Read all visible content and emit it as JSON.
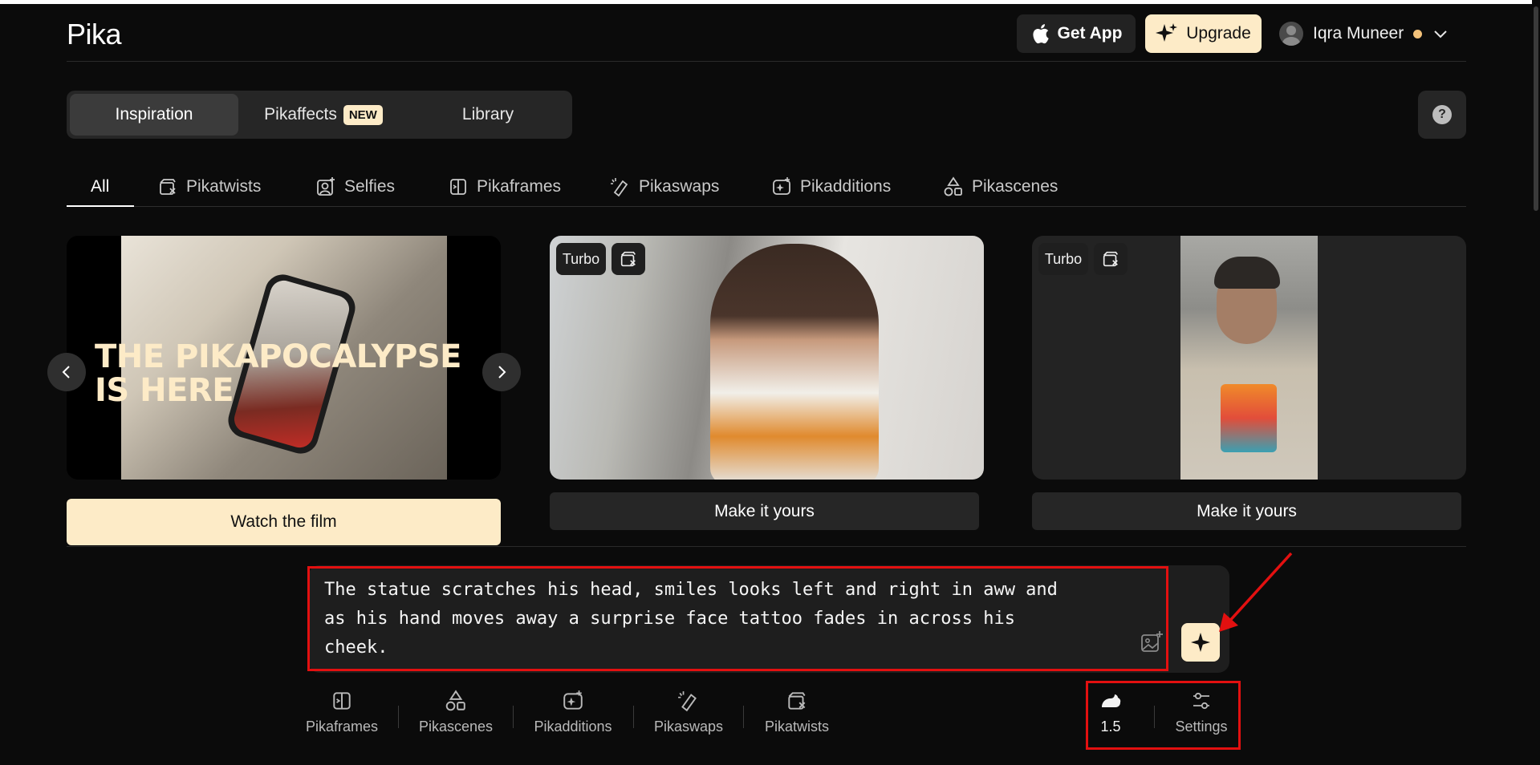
{
  "app": {
    "logo": "Pika"
  },
  "header": {
    "get_app_label": "Get App",
    "upgrade_label": "Upgrade",
    "user_name": "Iqra Muneer"
  },
  "main_tabs": [
    {
      "label": "Inspiration",
      "active": true
    },
    {
      "label": "Pikaffects",
      "badge": "NEW",
      "active": false
    },
    {
      "label": "Library",
      "active": false
    }
  ],
  "help_label": "?",
  "filters": [
    {
      "label": "All",
      "active": true
    },
    {
      "label": "Pikatwists",
      "icon": "pikatwists-icon"
    },
    {
      "label": "Selfies",
      "icon": "selfies-icon"
    },
    {
      "label": "Pikaframes",
      "icon": "pikaframes-icon"
    },
    {
      "label": "Pikaswaps",
      "icon": "pikaswaps-icon"
    },
    {
      "label": "Pikadditions",
      "icon": "pikadditions-icon"
    },
    {
      "label": "Pikascenes",
      "icon": "pikascenes-icon"
    }
  ],
  "cards": [
    {
      "overlay_title": "THE PIKAPOCALYPSE IS HERE",
      "cta": "Watch the film"
    },
    {
      "chip": "Turbo",
      "cta": "Make it yours"
    },
    {
      "chip": "Turbo",
      "cta": "Make it yours"
    }
  ],
  "prompt": {
    "text": "The statue scratches his head, smiles looks left and right in aww and\nas his hand moves away a surprise face tattoo fades in across his\ncheek."
  },
  "tools": [
    {
      "label": "Pikaframes",
      "icon": "pikaframes-icon"
    },
    {
      "label": "Pikascenes",
      "icon": "pikascenes-icon"
    },
    {
      "label": "Pikadditions",
      "icon": "pikadditions-icon"
    },
    {
      "label": "Pikaswaps",
      "icon": "pikaswaps-icon"
    },
    {
      "label": "Pikatwists",
      "icon": "pikatwists-icon"
    }
  ],
  "model": {
    "version": "1.5",
    "icon": "rabbit-icon"
  },
  "settings_label": "Settings",
  "colors": {
    "accent": "#fdebc7",
    "background": "#0b0b0b",
    "annotation": "#e31010"
  }
}
